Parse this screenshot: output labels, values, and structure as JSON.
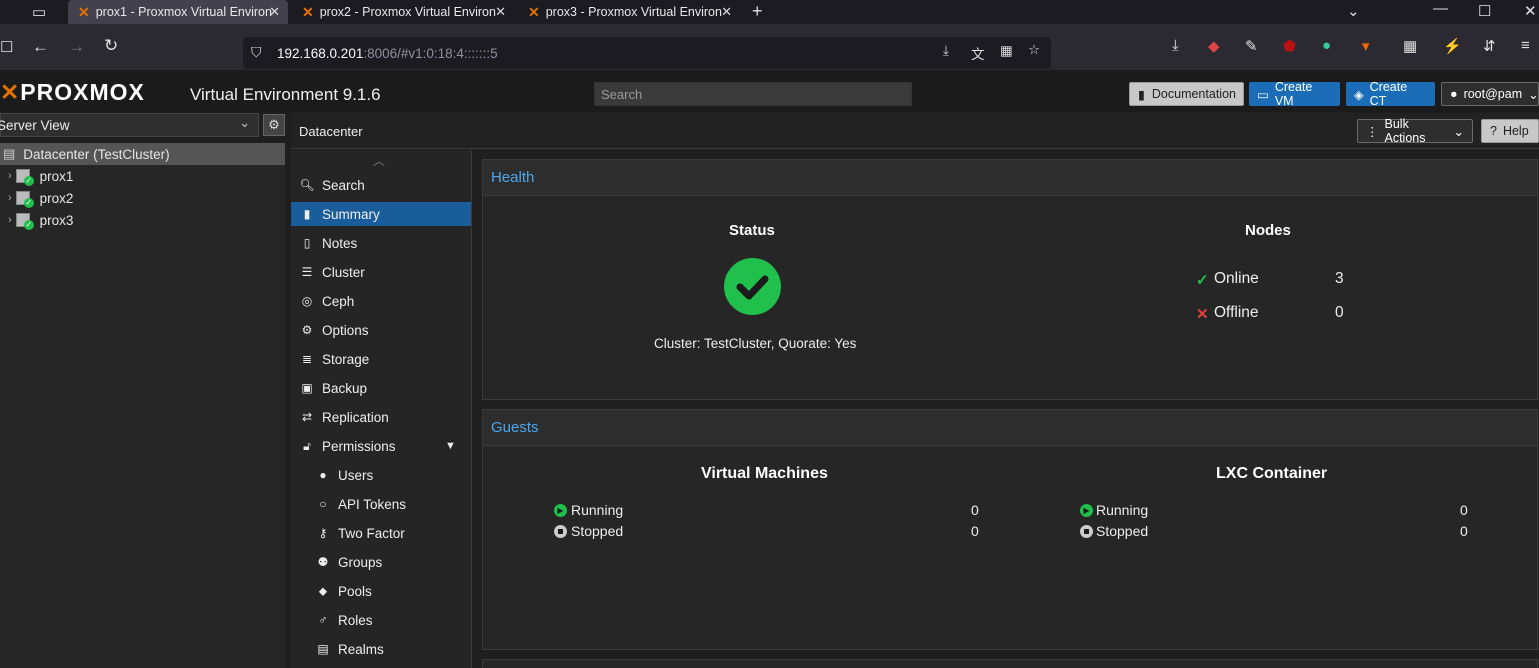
{
  "browser": {
    "tabs": [
      {
        "title": "prox1 - Proxmox Virtual Environ"
      },
      {
        "title": "prox2 - Proxmox Virtual Environ"
      },
      {
        "title": "prox3 - Proxmox Virtual Environ"
      }
    ],
    "url_host": "192.168.0.201",
    "url_rest": ":8006/#v1:0:18:4:::::::5"
  },
  "header": {
    "logo": "PROXMOX",
    "version": "Virtual Environment 9.1.6",
    "search_placeholder": "Search",
    "documentation": "Documentation",
    "create_vm": "Create VM",
    "create_ct": "Create CT",
    "user": "root@pam"
  },
  "tree": {
    "view": "Server View",
    "datacenter": "Datacenter (TestCluster)",
    "nodes": [
      "prox1",
      "prox2",
      "prox3"
    ]
  },
  "breadcrumb": {
    "title": "Datacenter",
    "bulk_actions": "Bulk Actions",
    "help": "Help"
  },
  "nav": [
    {
      "label": "Search",
      "icon": "search-icon"
    },
    {
      "label": "Summary",
      "icon": "book-icon"
    },
    {
      "label": "Notes",
      "icon": "note-icon"
    },
    {
      "label": "Cluster",
      "icon": "server-icon"
    },
    {
      "label": "Ceph",
      "icon": "ceph-icon"
    },
    {
      "label": "Options",
      "icon": "gear-icon"
    },
    {
      "label": "Storage",
      "icon": "database-icon"
    },
    {
      "label": "Backup",
      "icon": "save-icon"
    },
    {
      "label": "Replication",
      "icon": "retweet-icon"
    },
    {
      "label": "Permissions",
      "icon": "unlock-icon"
    },
    {
      "label": "Users",
      "icon": "user-icon"
    },
    {
      "label": "API Tokens",
      "icon": "user-outline-icon"
    },
    {
      "label": "Two Factor",
      "icon": "key-icon"
    },
    {
      "label": "Groups",
      "icon": "users-icon"
    },
    {
      "label": "Pools",
      "icon": "tags-icon"
    },
    {
      "label": "Roles",
      "icon": "male-icon"
    },
    {
      "label": "Realms",
      "icon": "address-book-icon"
    }
  ],
  "health": {
    "title": "Health",
    "status_title": "Status",
    "status_text": "Cluster: TestCluster, Quorate: Yes",
    "nodes_title": "Nodes",
    "online_label": "Online",
    "online_value": "3",
    "offline_label": "Offline",
    "offline_value": "0"
  },
  "guests": {
    "title": "Guests",
    "vm_title": "Virtual Machines",
    "ct_title": "LXC Container",
    "running_label": "Running",
    "stopped_label": "Stopped",
    "vm_running": "0",
    "vm_stopped": "0",
    "ct_running": "0",
    "ct_stopped": "0"
  },
  "colors": {
    "accent": "#1a5d9b",
    "ok_green": "#21bf4b",
    "error_red": "#e0413c",
    "brand_orange": "#e57000",
    "section_title": "#4ea7ee"
  }
}
